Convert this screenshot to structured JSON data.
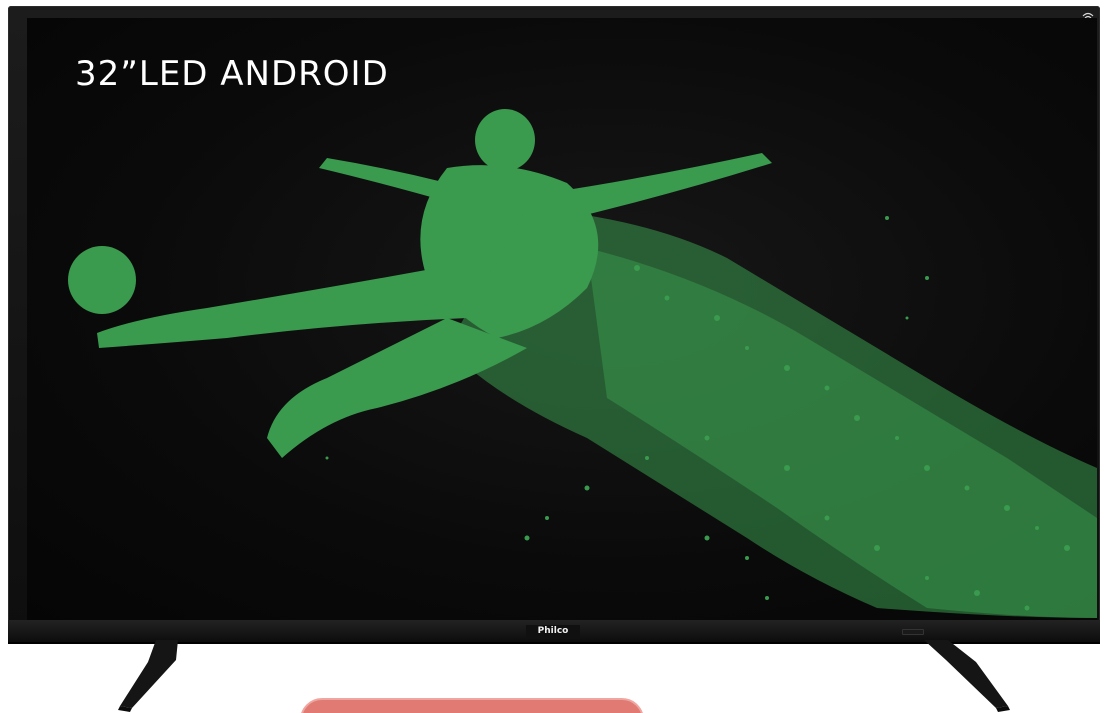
{
  "screen": {
    "headline": "32”LED ANDROID"
  },
  "brand": {
    "logo": "Philco"
  },
  "icons": {
    "wifi": "wifi-icon"
  },
  "colors": {
    "screen": "#0a0a0a",
    "frame": "#111111",
    "art": "#3a9a4e",
    "button": "#e07a72"
  }
}
